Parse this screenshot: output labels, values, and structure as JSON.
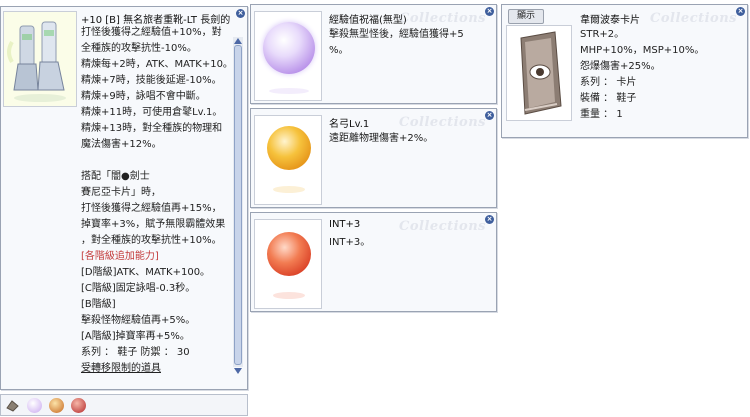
{
  "main_item": {
    "title": "+10 [B] 無名旅者重靴-LT 長劍的",
    "lines": [
      "打怪後獲得之經驗值+10%，對",
      "全種族的攻擊抗性-10%。",
      "精煉每+2時，ATK、MATK+10。",
      "精煉+7時，技能後延遲-10%。",
      "精煉+9時，詠唱不會中斷。",
      "精煉+11時，可使用倉鼕Lv.1。",
      "精煉+13時，對全種族的物理和",
      "魔法傷害+12%。",
      "",
      "搭配「闇●劍士",
      "賽尼亞卡片」時，",
      "  打怪後獲得之經驗值再+15%，",
      "  掉寶率+3%，賦予無限霸體效果",
      "  ，對全種族的攻擊抗性+10%。"
    ],
    "grade_title": "[各階級追加能力]",
    "grade_lines": [
      "[D階級]ATK、MATK+100。",
      "[C階級]固定詠唱-0.3秒。",
      "[B階級]",
      "擊殺怪物經驗值再+5%。",
      "[A階級]掉寶率再+5%。"
    ],
    "footer_stats": "系列 ： 鞋子   防禦 ： 30",
    "footer_link": "受轉移限制的道具"
  },
  "enchant_1": {
    "title": "經驗值祝福(無型)",
    "lines": [
      "擊殺無型怪後，經驗值獲得+5",
      "%。"
    ]
  },
  "enchant_2": {
    "title": "名弓Lv.1",
    "lines": [
      "遠距離物理傷害+2%。"
    ]
  },
  "enchant_3": {
    "title": "INT+3",
    "lines": [
      "INT+3。"
    ]
  },
  "card": {
    "show_button": "顯示",
    "title": "韋爾波泰卡片",
    "lines": [
      "STR+2。",
      "MHP+10%，MSP+10%。",
      "怨爆傷害+25%。",
      "系列 ： 卡片",
      "裝備 ： 鞋子",
      "重量 ： 1"
    ]
  },
  "watermark": "Collections",
  "close_glyph": "×",
  "colors": {
    "orb_purple": "#c9a8f0",
    "orb_gold": "#f2a71a",
    "orb_red": "#e8502f"
  }
}
